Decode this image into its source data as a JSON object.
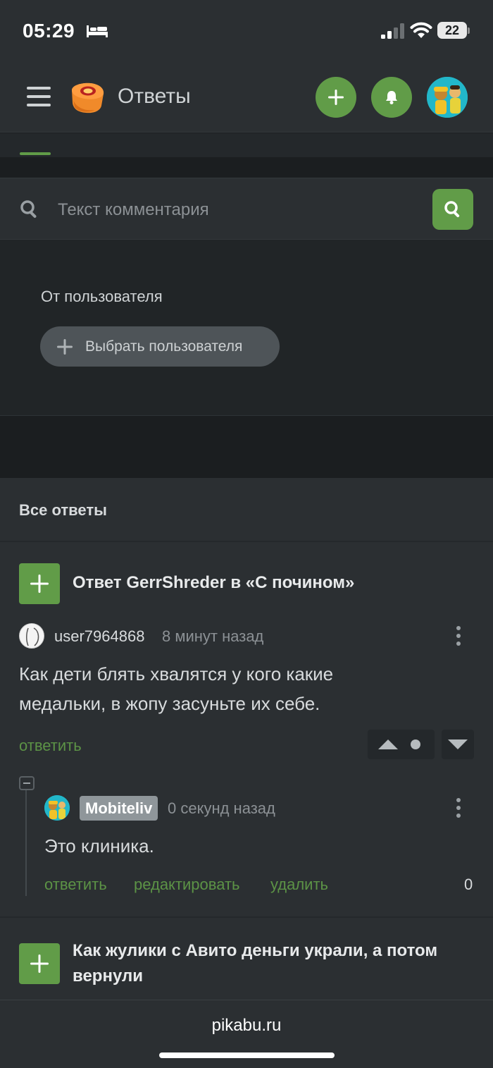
{
  "status_bar": {
    "time": "05:29",
    "battery_level": "22"
  },
  "header": {
    "title": "Ответы",
    "icons": [
      "menu-icon",
      "pikabu-logo",
      "plus-icon",
      "bell-icon",
      "avatar"
    ]
  },
  "search": {
    "placeholder": "Текст комментария"
  },
  "filter": {
    "label": "От пользователя",
    "choose_button": "Выбрать пользователя"
  },
  "answers": {
    "title": "Все ответы",
    "items": [
      {
        "post_title": "Ответ GerrShreder в «С почином»",
        "comment": {
          "username": "user7964868",
          "time": "8 минут назад",
          "text": "Как дети блять хвалятся у кого какие медальки, в жопу засуньте их себе.",
          "reply_link": "ответить"
        },
        "reply": {
          "username": "Mobiteliv",
          "time": "0 секунд назад",
          "text": "Это клиника.",
          "actions": [
            "ответить",
            "редактировать",
            "удалить"
          ],
          "score": "0"
        }
      },
      {
        "post_title": "Как жулики с Авито деньги украли, а потом вернули"
      }
    ]
  },
  "bottom_bar": {
    "domain": "pikabu.ru"
  },
  "colors": {
    "accent": "#619c48",
    "link": "#5c9346",
    "background": "#1b1e20",
    "card": "#2b2f32"
  }
}
